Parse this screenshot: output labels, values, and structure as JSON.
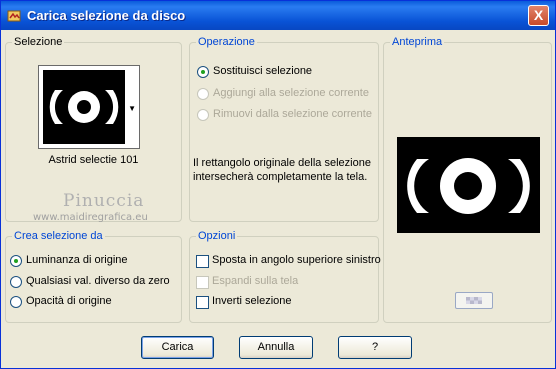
{
  "window": {
    "title": "Carica selezione da disco",
    "close_label": "X"
  },
  "selezione": {
    "label": "Selezione",
    "selection_name": "Astrid selectie 101"
  },
  "operazione": {
    "label": "Operazione",
    "options": [
      {
        "label": "Sostituisci selezione",
        "selected": true,
        "enabled": true
      },
      {
        "label": "Aggiungi alla selezione corrente",
        "selected": false,
        "enabled": false
      },
      {
        "label": "Rimuovi dalla selezione corrente",
        "selected": false,
        "enabled": false
      }
    ],
    "info": "Il rettangolo originale della selezione intersecherà completamente la tela."
  },
  "anteprima": {
    "label": "Anteprima"
  },
  "crea": {
    "label": "Crea selezione da",
    "options": [
      {
        "label": "Luminanza di origine",
        "selected": true
      },
      {
        "label": "Qualsiasi val. diverso da zero",
        "selected": false
      },
      {
        "label": "Opacità di origine",
        "selected": false
      }
    ]
  },
  "opzioni": {
    "label": "Opzioni",
    "checks": [
      {
        "label": "Sposta in angolo superiore sinistro",
        "checked": false,
        "enabled": true
      },
      {
        "label": "Espandi sulla tela",
        "checked": false,
        "enabled": false
      },
      {
        "label": "Inverti selezione",
        "checked": false,
        "enabled": true
      }
    ]
  },
  "watermark": {
    "name": "Pinuccia",
    "site": "www.maidiregrafica.eu"
  },
  "buttons": {
    "load": "Carica",
    "cancel": "Annulla",
    "help": "?"
  },
  "colors": {
    "title_bar": "#0a5bdb",
    "group_label": "#0046d5",
    "radio_dot": "#21a121",
    "dialog_bg": "#ece9d8"
  }
}
